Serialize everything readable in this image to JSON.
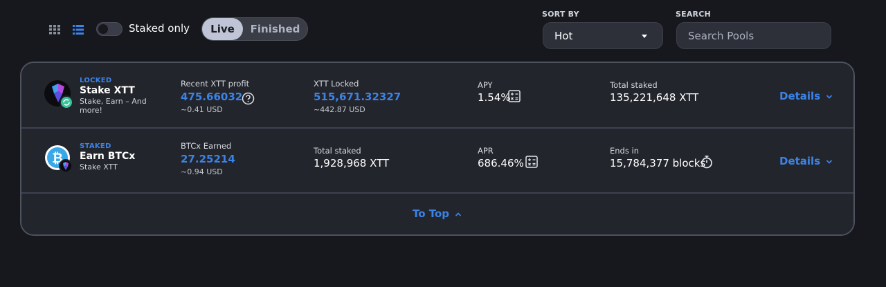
{
  "toolbar": {
    "staked_only_label": "Staked only",
    "tabs": [
      "Live",
      "Finished"
    ],
    "sort_by_label": "SORT BY",
    "sort_value": "Hot",
    "search_label": "SEARCH",
    "search_placeholder": "Search Pools"
  },
  "pools": [
    {
      "tag": "LOCKED",
      "name": "Stake XTT",
      "subtitle": "Stake, Earn – And more!",
      "col1_label": "Recent XTT profit",
      "col1_value": "475.66032",
      "col1_sub": "~0.41 USD",
      "col2_label": "XTT Locked",
      "col2_value": "515,671.32327",
      "col2_sub": "~442.87 USD",
      "col3_label": "APY",
      "col3_value": "1.54%",
      "col4_label": "Total staked",
      "col4_value": "135,221,648 XTT",
      "details_label": "Details"
    },
    {
      "tag": "STAKED",
      "name": "Earn BTCx",
      "subtitle": "Stake XTT",
      "col1_label": "BTCx Earned",
      "col1_value": "27.25214",
      "col1_sub": "~0.94 USD",
      "col2_label": "Total staked",
      "col2_value": "1,928,968 XTT",
      "col3_label": "APR",
      "col3_value": "686.46%",
      "col4_label": "Ends in",
      "col4_value": "15,784,377 blocks",
      "details_label": "Details"
    }
  ],
  "footer": {
    "to_top_label": "To Top"
  },
  "colors": {
    "accent": "#3c83e6",
    "background": "#17181d",
    "card": "#23252c"
  }
}
